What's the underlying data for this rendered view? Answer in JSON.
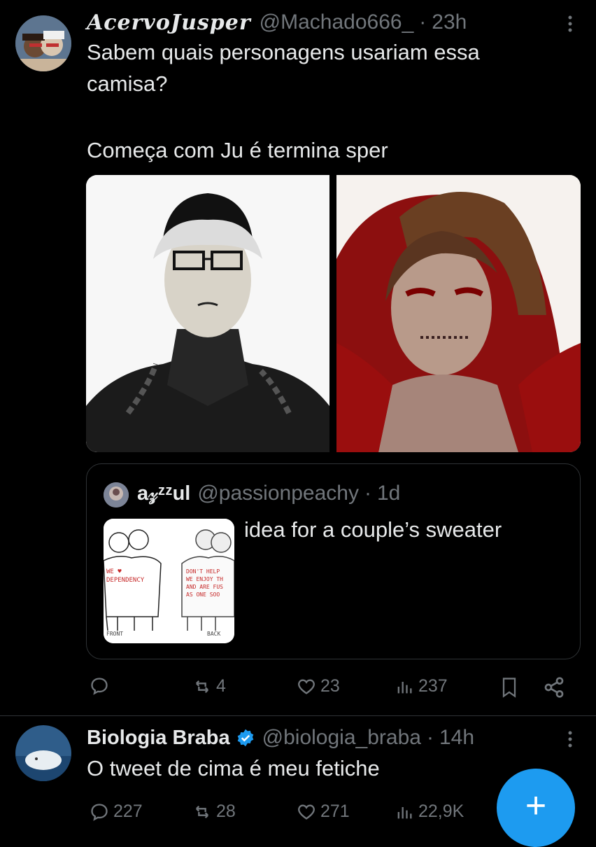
{
  "tweet1": {
    "display_name": "AcervoJusper",
    "handle": "@Machado666_",
    "dot": "·",
    "time": "23h",
    "text_line1": "Sabem quais personagens usariam essa",
    "text_line2": "camisa?",
    "text_line3": "Começa com Ju é termina sper",
    "quote": {
      "display_name": "a𝓏ᶻᶻul",
      "handle": "@passionpeachy",
      "dot": "·",
      "time": "1d",
      "text": "idea for a couple’s sweater",
      "image_left_text": [
        "WE ♥",
        "DEPENDENCY"
      ],
      "image_right_text": [
        "DON'T HELP",
        "WE ENJOY TH",
        "AND ARE FUS",
        "AS ONE SOO"
      ],
      "image_front": "FRONT",
      "image_back": "BACK"
    },
    "actions": {
      "replies": "",
      "reposts": "4",
      "likes": "23",
      "views": "237"
    }
  },
  "tweet2": {
    "display_name": "Biologia Braba",
    "handle": "@biologia_braba",
    "dot": "·",
    "time": "14h",
    "text": "O tweet de cima é meu fetiche",
    "actions": {
      "replies": "227",
      "reposts": "28",
      "likes": "271",
      "views": "22,9K"
    }
  },
  "fab": {
    "label": "+"
  },
  "colors": {
    "background": "#000000",
    "text": "#e7e9ea",
    "muted": "#71767b",
    "accent": "#1d9bf0",
    "divider": "#2f3336"
  }
}
